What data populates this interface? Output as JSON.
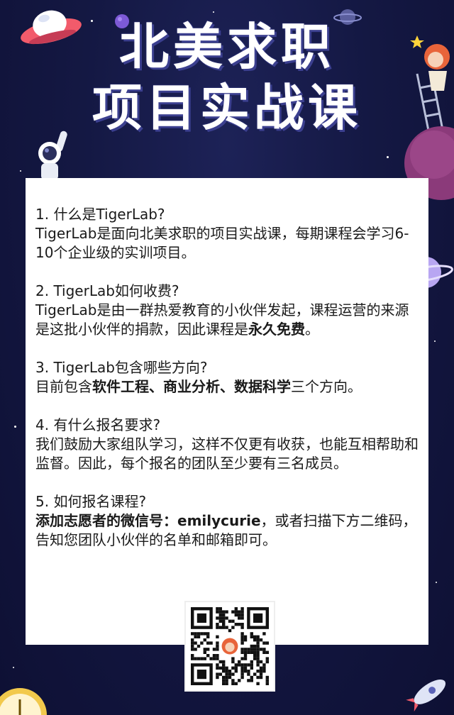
{
  "header": {
    "title_line1": "北美求职",
    "title_line2": "项目实战课"
  },
  "faq": [
    {
      "question": "1. 什么是TigerLab?",
      "answer_parts": [
        "TigerLab是面向北美求职的项目实战课，每期课程会学习6-10个企业级的实训项目。"
      ]
    },
    {
      "question": "2. TigerLab如何收费?",
      "answer_parts": [
        "TigerLab是由一群热爱教育的小伙伴发起，课程运营的来源是这批小伙伴的捐款，因此课程是",
        "永久免费",
        "。"
      ]
    },
    {
      "question": "3. TigerLab包含哪些方向?",
      "answer_parts": [
        "目前包含",
        "软件工程、商业分析、数据科学",
        "三个方向。"
      ]
    },
    {
      "question": "4. 有什么报名要求?",
      "answer_parts": [
        "我们鼓励大家组队学习，这样不仅更有收获，也能互相帮助和监督。因此，每个报名的团队至少要有三名成员。"
      ]
    },
    {
      "question": "5. 如何报名课程?",
      "answer_parts": [
        "添加志愿者的微信号：emilycurie",
        "，或者扫描下方二维码，告知您团队小伙伴的名单和邮箱即可。"
      ]
    }
  ],
  "qr": {
    "icon": "qr-code-icon"
  },
  "colors": {
    "background": "#11143a",
    "title": "#ffffff",
    "title_shadow": "#3b3f8f",
    "card": "#ffffff",
    "text": "#1a1a1a"
  }
}
